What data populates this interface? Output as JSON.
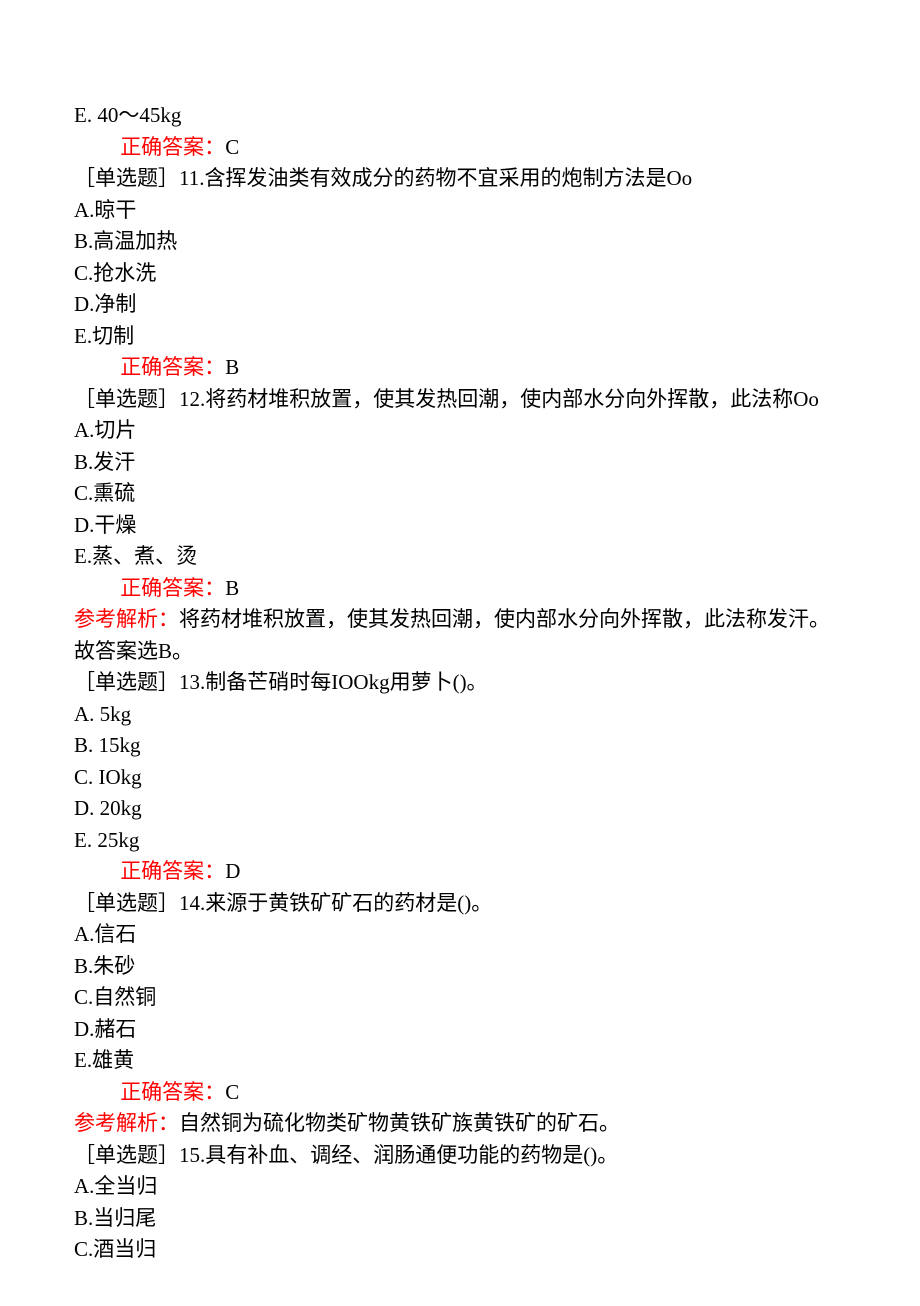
{
  "q10_optE": "E. 40～45kg",
  "ans_label": "正确答案：",
  "q10_ans": "C",
  "q11_stem": "［单选题］11.含挥发油类有效成分的药物不宜采用的炮制方法是Oo",
  "q11_A": "A.晾干",
  "q11_B": "B.高温加热",
  "q11_C": "C.抢水洗",
  "q11_D": "D.净制",
  "q11_E": "E.切制",
  "q11_ans": "B",
  "q12_stem": "［单选题］12.将药材堆积放置，使其发热回潮，使内部水分向外挥散，此法称Oo",
  "q12_A": "A.切片",
  "q12_B": "B.发汗",
  "q12_C": "C.熏硫",
  "q12_D": "D.干燥",
  "q12_E": "E.蒸、煮、烫",
  "q12_ans": "B",
  "analysis_label": "参考解析：",
  "q12_analysis": "将药材堆积放置，使其发热回潮，使内部水分向外挥散，此法称发汗。故答案选B。",
  "q13_stem": "［单选题］13.制备芒硝时每IOOkg用萝卜()。",
  "q13_A": "A. 5kg",
  "q13_B": "B. 15kg",
  "q13_C": "C. IOkg",
  "q13_D": "D. 20kg",
  "q13_E": "E. 25kg",
  "q13_ans": "D",
  "q14_stem": "［单选题］14.来源于黄铁矿矿石的药材是()。",
  "q14_A": "A.信石",
  "q14_B": "B.朱砂",
  "q14_C": "C.自然铜",
  "q14_D": "D.赭石",
  "q14_E": "E.雄黄",
  "q14_ans": "C",
  "q14_analysis": "自然铜为硫化物类矿物黄铁矿族黄铁矿的矿石。",
  "q15_stem": "［单选题］15.具有补血、调经、润肠通便功能的药物是()。",
  "q15_A": "A.全当归",
  "q15_B": "B.当归尾",
  "q15_C": "C.酒当归"
}
